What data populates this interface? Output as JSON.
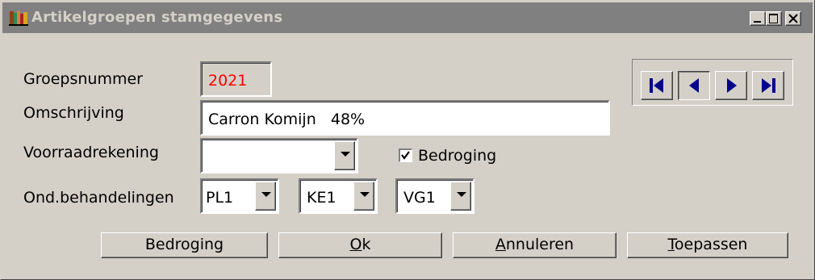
{
  "window": {
    "title": "Artikelgroepen stamgegevens",
    "controls": [
      "minimize",
      "maximize",
      "close"
    ]
  },
  "form": {
    "groepsnummer": {
      "label": "Groepsnummer",
      "value": "2021",
      "value_color": "#ff0000"
    },
    "omschrijving": {
      "label": "Omschrijving",
      "value": "Carron Komijn   48%"
    },
    "voorraadrekening": {
      "label": "Voorraadrekening",
      "value": ""
    },
    "bedroging_checkbox": {
      "label": "Bedroging",
      "checked": true
    },
    "ond_behandelingen": {
      "label": "Ond.behandelingen",
      "selects": [
        {
          "value": "PL1"
        },
        {
          "value": "KE1"
        },
        {
          "value": "VG1"
        }
      ]
    }
  },
  "navigation": {
    "buttons": [
      "first-icon",
      "previous-icon",
      "next-icon",
      "last-icon"
    ],
    "icon_color": "#00008b"
  },
  "buttons": {
    "bedroging": "Bedroging",
    "ok_prefix": "O",
    "ok_rest": "k",
    "annuleren_prefix": "A",
    "annuleren_rest": "nnuleren",
    "toepassen_prefix": "T",
    "toepassen_rest": "oepassen"
  }
}
